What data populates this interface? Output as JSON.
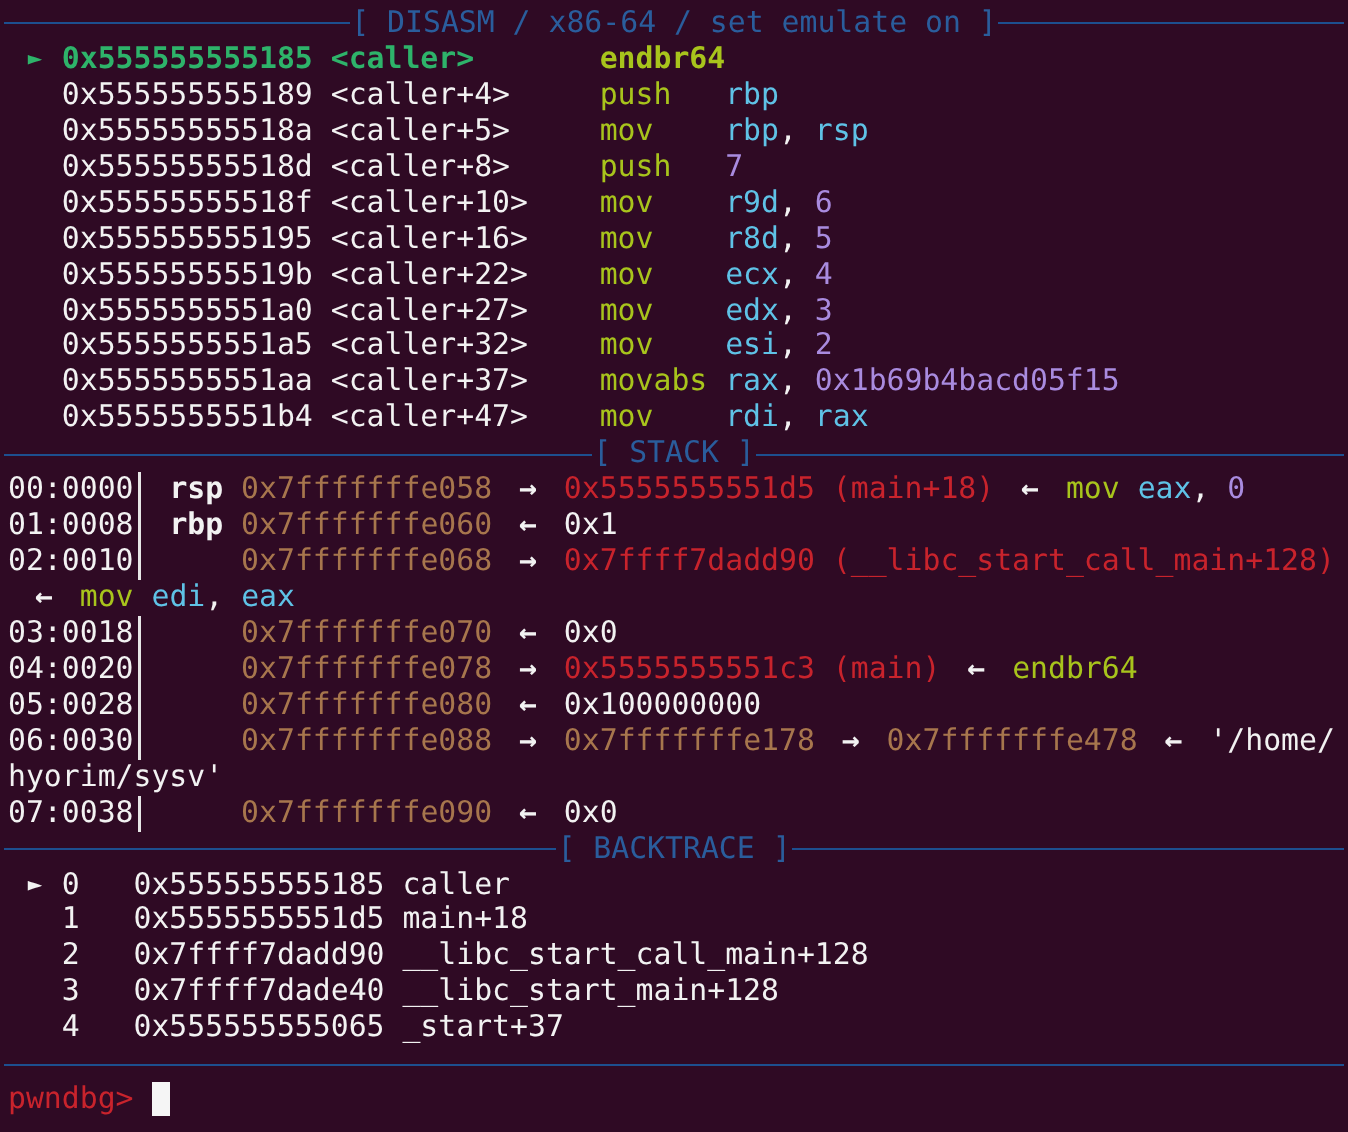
{
  "disasm": {
    "title": "[ DISASM / x86-64 / set emulate on ]",
    "rows": [
      {
        "selected": true,
        "marker": "►",
        "address": "0x555555555185",
        "symbol": "<caller>",
        "mnemonic": "endbr64"
      },
      {
        "selected": false,
        "address": "0x555555555189",
        "symbol": "<caller+4>",
        "mnemonic": "push",
        "operands": [
          {
            "kind": "register",
            "text": "rbp"
          }
        ]
      },
      {
        "selected": false,
        "address": "0x55555555518a",
        "symbol": "<caller+5>",
        "mnemonic": "mov",
        "operands": [
          {
            "kind": "register",
            "text": "rbp"
          },
          {
            "kind": "punct",
            "text": ","
          },
          {
            "kind": "register",
            "text": "rsp"
          }
        ]
      },
      {
        "selected": false,
        "address": "0x55555555518d",
        "symbol": "<caller+8>",
        "mnemonic": "push",
        "operands": [
          {
            "kind": "number",
            "text": "7"
          }
        ]
      },
      {
        "selected": false,
        "address": "0x55555555518f",
        "symbol": "<caller+10>",
        "mnemonic": "mov",
        "operands": [
          {
            "kind": "register",
            "text": "r9d"
          },
          {
            "kind": "punct",
            "text": ","
          },
          {
            "kind": "number",
            "text": "6"
          }
        ]
      },
      {
        "selected": false,
        "address": "0x555555555195",
        "symbol": "<caller+16>",
        "mnemonic": "mov",
        "operands": [
          {
            "kind": "register",
            "text": "r8d"
          },
          {
            "kind": "punct",
            "text": ","
          },
          {
            "kind": "number",
            "text": "5"
          }
        ]
      },
      {
        "selected": false,
        "address": "0x55555555519b",
        "symbol": "<caller+22>",
        "mnemonic": "mov",
        "operands": [
          {
            "kind": "register",
            "text": "ecx"
          },
          {
            "kind": "punct",
            "text": ","
          },
          {
            "kind": "number",
            "text": "4"
          }
        ]
      },
      {
        "selected": false,
        "address": "0x5555555551a0",
        "symbol": "<caller+27>",
        "mnemonic": "mov",
        "operands": [
          {
            "kind": "register",
            "text": "edx"
          },
          {
            "kind": "punct",
            "text": ","
          },
          {
            "kind": "number",
            "text": "3"
          }
        ]
      },
      {
        "selected": false,
        "address": "0x5555555551a5",
        "symbol": "<caller+32>",
        "mnemonic": "mov",
        "operands": [
          {
            "kind": "register",
            "text": "esi"
          },
          {
            "kind": "punct",
            "text": ","
          },
          {
            "kind": "number",
            "text": "2"
          }
        ]
      },
      {
        "selected": false,
        "address": "0x5555555551aa",
        "symbol": "<caller+37>",
        "mnemonic": "movabs",
        "operands": [
          {
            "kind": "register",
            "text": "rax"
          },
          {
            "kind": "punct",
            "text": ","
          },
          {
            "kind": "number",
            "text": "0x1b69b4bacd05f15"
          }
        ]
      },
      {
        "selected": false,
        "address": "0x5555555551b4",
        "symbol": "<caller+47>",
        "mnemonic": "mov",
        "operands": [
          {
            "kind": "register",
            "text": "rdi"
          },
          {
            "kind": "punct",
            "text": ","
          },
          {
            "kind": "register",
            "text": "rax"
          }
        ]
      }
    ]
  },
  "stack": {
    "title": "[ STACK ]",
    "rows": [
      {
        "offset": "00:0000",
        "register": "rsp",
        "chain": [
          {
            "kind": "stack",
            "text": "0x7fffffffe058"
          },
          {
            "kind": "arrow",
            "text": "→"
          },
          {
            "kind": "code",
            "text": "0x5555555551d5"
          },
          {
            "kind": "code",
            "text": "(main+18)"
          },
          {
            "kind": "arrow",
            "text": "←"
          },
          {
            "kind": "mnemonic",
            "text": "mov"
          },
          {
            "kind": "register",
            "text": "eax"
          },
          {
            "kind": "punct",
            "text": ","
          },
          {
            "kind": "number",
            "text": "0"
          }
        ]
      },
      {
        "offset": "01:0008",
        "register": "rbp",
        "chain": [
          {
            "kind": "stack",
            "text": "0x7fffffffe060"
          },
          {
            "kind": "arrow",
            "text": "←"
          },
          {
            "kind": "plain",
            "text": "0x1"
          }
        ]
      },
      {
        "offset": "02:0010",
        "chain": [
          {
            "kind": "stack",
            "text": "0x7fffffffe068"
          },
          {
            "kind": "arrow",
            "text": "→"
          },
          {
            "kind": "code",
            "text": "0x7ffff7dadd90"
          },
          {
            "kind": "code",
            "text": "(__libc_start_call_main+128)"
          }
        ],
        "continuation": [
          {
            "kind": "arrow",
            "text": "←"
          },
          {
            "kind": "mnemonic",
            "text": "mov"
          },
          {
            "kind": "register",
            "text": "edi"
          },
          {
            "kind": "punct",
            "text": ","
          },
          {
            "kind": "register",
            "text": "eax"
          }
        ]
      },
      {
        "offset": "03:0018",
        "chain": [
          {
            "kind": "stack",
            "text": "0x7fffffffe070"
          },
          {
            "kind": "arrow",
            "text": "←"
          },
          {
            "kind": "plain",
            "text": "0x0"
          }
        ]
      },
      {
        "offset": "04:0020",
        "chain": [
          {
            "kind": "stack",
            "text": "0x7fffffffe078"
          },
          {
            "kind": "arrow",
            "text": "→"
          },
          {
            "kind": "code",
            "text": "0x5555555551c3"
          },
          {
            "kind": "code",
            "text": "(main)"
          },
          {
            "kind": "arrow",
            "text": "←"
          },
          {
            "kind": "mnemonic",
            "text": "endbr64"
          }
        ]
      },
      {
        "offset": "05:0028",
        "chain": [
          {
            "kind": "stack",
            "text": "0x7fffffffe080"
          },
          {
            "kind": "arrow",
            "text": "←"
          },
          {
            "kind": "plain",
            "text": "0x100000000"
          }
        ]
      },
      {
        "offset": "06:0030",
        "chain": [
          {
            "kind": "stack",
            "text": "0x7fffffffe088"
          },
          {
            "kind": "arrow",
            "text": "→"
          },
          {
            "kind": "stack",
            "text": "0x7fffffffe178"
          },
          {
            "kind": "arrow",
            "text": "→"
          },
          {
            "kind": "stack",
            "text": "0x7fffffffe478"
          },
          {
            "kind": "arrow",
            "text": "←"
          },
          {
            "kind": "string",
            "text": "'/home/"
          }
        ],
        "continuation": [
          {
            "kind": "string",
            "text": "hyorim/sysv'"
          }
        ]
      },
      {
        "offset": "07:0038",
        "chain": [
          {
            "kind": "stack",
            "text": "0x7fffffffe090"
          },
          {
            "kind": "arrow",
            "text": "←"
          },
          {
            "kind": "plain",
            "text": "0x0"
          }
        ]
      }
    ]
  },
  "backtrace": {
    "title": "[ BACKTRACE ]",
    "frames": [
      {
        "marker": "►",
        "number": "0",
        "address": "0x555555555185",
        "symbol": "caller"
      },
      {
        "number": "1",
        "address": "0x5555555551d5",
        "symbol": "main+18"
      },
      {
        "number": "2",
        "address": "0x7ffff7dadd90",
        "symbol": "__libc_start_call_main+128"
      },
      {
        "number": "3",
        "address": "0x7ffff7dade40",
        "symbol": "__libc_start_main+128"
      },
      {
        "number": "4",
        "address": "0x555555555065",
        "symbol": "_start+37"
      }
    ]
  },
  "prompt": {
    "text": "pwndbg>"
  }
}
